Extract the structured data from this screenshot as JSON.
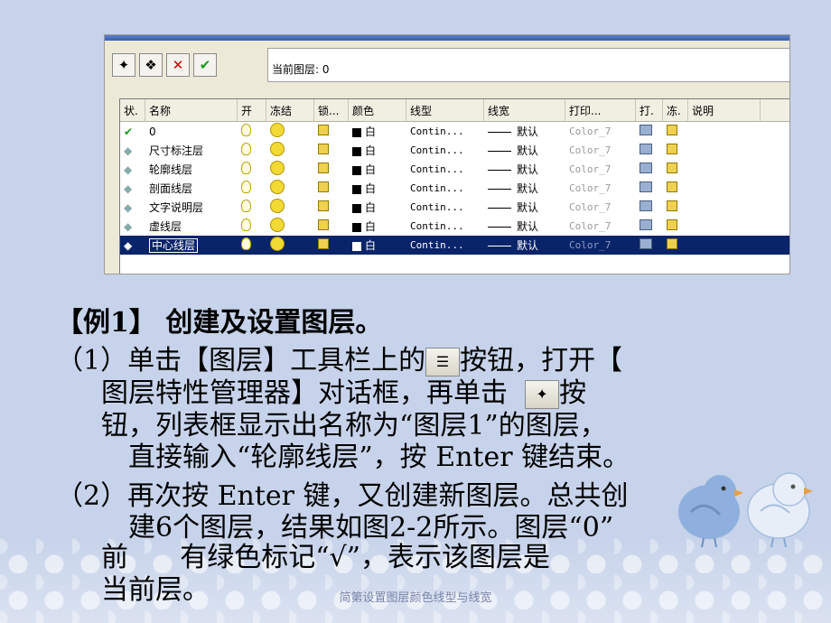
{
  "dialog": {
    "current_layer_label": "当前图层: 0",
    "columns": [
      "状.",
      "名称",
      "开",
      "冻结",
      "锁...",
      "颜色",
      "线型",
      "线宽",
      "打印...",
      "打.",
      "冻.",
      "说明"
    ],
    "rows": [
      {
        "status": "check",
        "name": "0",
        "color": "白",
        "linetype": "Contin...",
        "lineweight": "默认",
        "plot_style": "Color_7"
      },
      {
        "status": "arrow",
        "name": "尺寸标注层",
        "color": "白",
        "linetype": "Contin...",
        "lineweight": "默认",
        "plot_style": "Color_7"
      },
      {
        "status": "arrow",
        "name": "轮廓线层",
        "color": "白",
        "linetype": "Contin...",
        "lineweight": "默认",
        "plot_style": "Color_7"
      },
      {
        "status": "arrow",
        "name": "剖面线层",
        "color": "白",
        "linetype": "Contin...",
        "lineweight": "默认",
        "plot_style": "Color_7"
      },
      {
        "status": "arrow",
        "name": "文字说明层",
        "color": "白",
        "linetype": "Contin...",
        "lineweight": "默认",
        "plot_style": "Color_7"
      },
      {
        "status": "arrow",
        "name": "虚线层",
        "color": "白",
        "linetype": "Contin...",
        "lineweight": "默认",
        "plot_style": "Color_7"
      },
      {
        "status": "arrow",
        "name": "中心线层",
        "color": "白",
        "linetype": "Contin...",
        "lineweight": "默认",
        "plot_style": "Color_7",
        "selected": true
      }
    ]
  },
  "content": {
    "heading": "【例1】  创建及设置图层。",
    "p1_a": "（1）单击【图层】工具栏上的",
    "p1_b": "按钮，打开【",
    "p1_c": "图层特性管理器】对话框，再单击",
    "p1_d": "按",
    "p1_e": "钮，列表框显示出名称为“图层1”的图层，",
    "p1_f": "直接输入“轮廓线层”，按 Enter 键结束。",
    "p2_a": "（2）再次按 Enter 键，又创建新图层。总共创",
    "p2_b": "建6个图层，结果如图2-2所示。图层“0”",
    "p2_c": "前      有绿色标记“√”，表示该图层是",
    "p2_d": "当前层。"
  },
  "footer": "简第设置图层颜色线型与线宽"
}
